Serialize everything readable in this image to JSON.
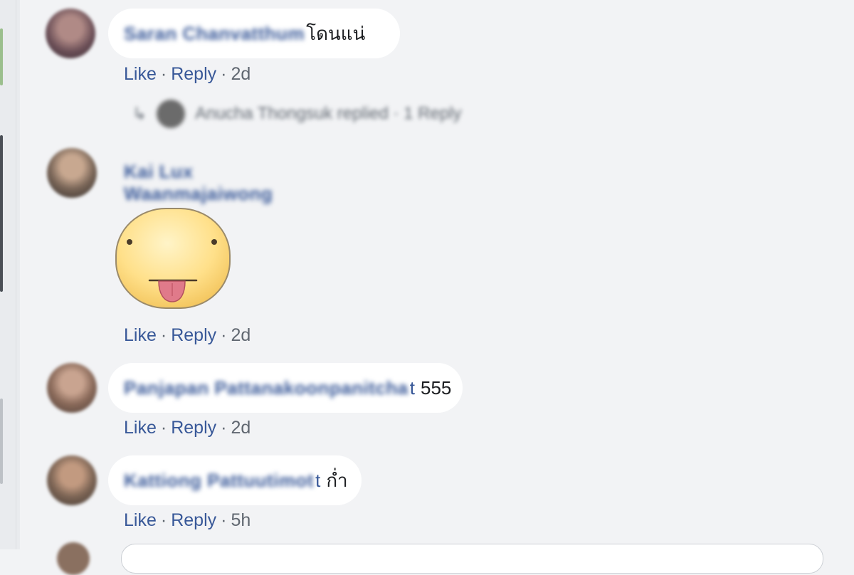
{
  "comments": [
    {
      "author": "Saran Chanvatthum",
      "text": "โดนแน่",
      "actions": {
        "like": "Like",
        "reply": "Reply",
        "time": "2d"
      },
      "replies_summary": "Anucha Thongsuk replied · 1 Reply"
    },
    {
      "author": "Kai Lux Waanmajaiwong",
      "text": "",
      "sticker": "tongue-out-face-sticker",
      "actions": {
        "like": "Like",
        "reply": "Reply",
        "time": "2d"
      }
    },
    {
      "author": "Panjapan Pattanakoonpanitcha",
      "author_visible_tail": "t",
      "text": "555",
      "actions": {
        "like": "Like",
        "reply": "Reply",
        "time": "2d"
      }
    },
    {
      "author": "Kattiong Pattuutimot",
      "author_visible_tail": "t",
      "text": "ก่ำ",
      "actions": {
        "like": "Like",
        "reply": "Reply",
        "time": "5h"
      }
    }
  ],
  "separator": "·",
  "colors": {
    "background": "#f2f3f5",
    "bubble": "#ffffff",
    "link": "#385898",
    "meta": "#606770",
    "text": "#1c1e21"
  }
}
